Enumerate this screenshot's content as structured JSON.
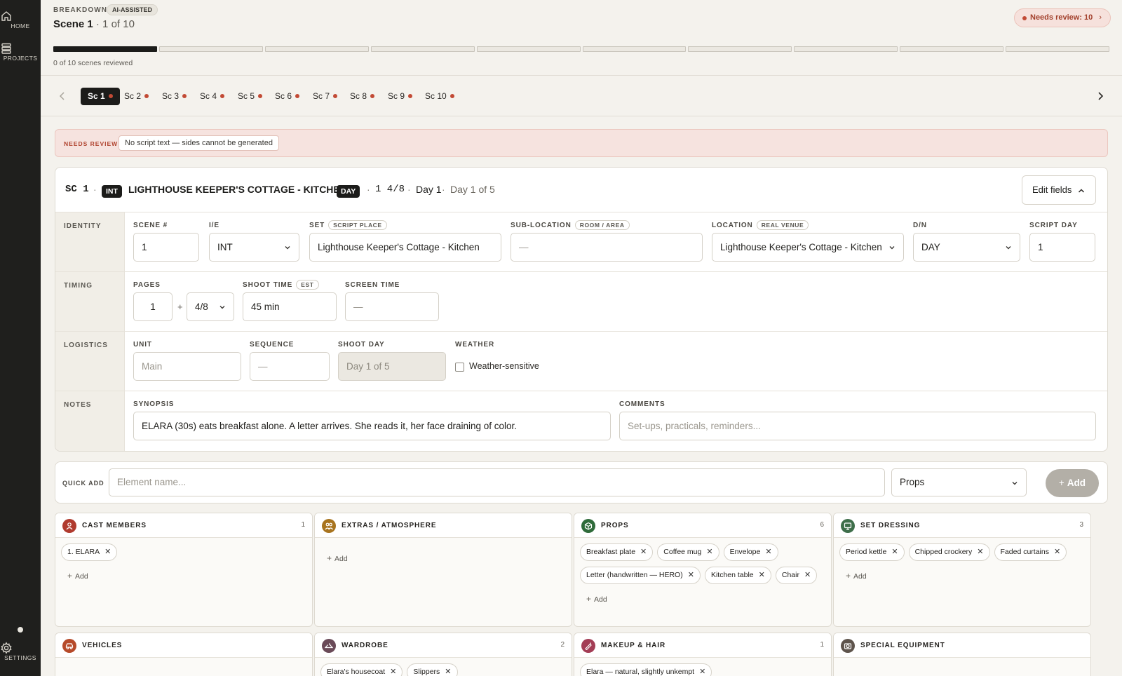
{
  "rail": {
    "home": "HOME",
    "projects": "PROJECTS",
    "settings": "SETTINGS"
  },
  "header": {
    "breadcrumb": "BREAKDOWN",
    "ai_badge": "AI-ASSISTED",
    "scene_title": "Scene 1",
    "scene_position": "· 1 of 10",
    "review_pill": "Needs review: 10",
    "scenes_reviewed_fraction": 0.1,
    "progress_label": "0 of 10 scenes reviewed"
  },
  "tabs": [
    {
      "label": "Sc 1"
    },
    {
      "label": "Sc 2"
    },
    {
      "label": "Sc 3"
    },
    {
      "label": "Sc 4"
    },
    {
      "label": "Sc 5"
    },
    {
      "label": "Sc 6"
    },
    {
      "label": "Sc 7"
    },
    {
      "label": "Sc 8"
    },
    {
      "label": "Sc 9"
    },
    {
      "label": "Sc 10"
    }
  ],
  "alert": {
    "label": "NEEDS REVIEW",
    "message": "No script text — sides cannot be generated"
  },
  "slugline": {
    "scene_code": "SC 1",
    "ie": "INT",
    "set": "LIGHTHOUSE KEEPER'S COTTAGE - KITCHEN",
    "dn": "DAY",
    "pages": "1 4/8",
    "script_day": "Day 1",
    "shoot_day": "Day 1 of 5",
    "edit_label": "Edit fields"
  },
  "sections": {
    "identity": "IDENTITY",
    "timing": "TIMING",
    "logistics": "LOGISTICS",
    "notes": "NOTES"
  },
  "identity": {
    "scene_label": "SCENE #",
    "scene_value": "1",
    "ie_label": "I/E",
    "ie_value": "INT",
    "set_label": "SET",
    "set_tag": "SCRIPT PLACE",
    "set_value": "Lighthouse Keeper's Cottage - Kitchen",
    "sublocation_label": "SUB-LOCATION",
    "sublocation_tag": "ROOM / AREA",
    "sublocation_value": "—",
    "location_label": "LOCATION",
    "location_tag": "REAL VENUE",
    "location_value": "Lighthouse Keeper's Cottage - Kitchen",
    "dn_label": "D/N",
    "dn_value": "DAY",
    "script_day_label": "SCRIPT DAY",
    "script_day_value": "1"
  },
  "timing": {
    "pages_label": "PAGES",
    "pages_whole": "1",
    "plus": "+",
    "pages_eighths": "4/8",
    "shoot_time_label": "SHOOT TIME",
    "shoot_time_tag": "EST",
    "shoot_time_value": "45 min",
    "screen_time_label": "SCREEN TIME",
    "screen_time_value": "—"
  },
  "logistics": {
    "unit_label": "UNIT",
    "unit_placeholder": "Main",
    "sequence_label": "SEQUENCE",
    "sequence_value": "—",
    "shoot_day_label": "SHOOT DAY",
    "shoot_day_value": "Day 1 of 5",
    "weather_label": "WEATHER",
    "weather_checkbox": "Weather-sensitive"
  },
  "notes": {
    "synopsis_label": "SYNOPSIS",
    "synopsis_value": "ELARA (30s) eats breakfast alone. A letter arrives. She reads it, her face draining of color.",
    "comments_label": "COMMENTS",
    "comments_placeholder": "Set-ups, practicals, reminders..."
  },
  "quick_add": {
    "label": "QUICK ADD",
    "placeholder": "Element name...",
    "category": "Props",
    "button": "Add"
  },
  "add_label": "Add",
  "categories": [
    {
      "title": "CAST MEMBERS",
      "count": "1",
      "color": "#b03a2e",
      "items": [
        "1. ELARA"
      ]
    },
    {
      "title": "EXTRAS / ATMOSPHERE",
      "count": "",
      "color": "#a8741f",
      "items": []
    },
    {
      "title": "PROPS",
      "count": "6",
      "color": "#2f6b3a",
      "items": [
        "Breakfast plate",
        "Coffee mug",
        "Envelope",
        "Letter (handwritten — HERO)",
        "Kitchen table",
        "Chair"
      ]
    },
    {
      "title": "SET DRESSING",
      "count": "3",
      "color": "#3e6e4a",
      "items": [
        "Period kettle",
        "Chipped crockery",
        "Faded curtains"
      ]
    },
    {
      "title": "VEHICLES",
      "count": "",
      "color": "#b64a2a",
      "items": []
    },
    {
      "title": "WARDROBE",
      "count": "2",
      "color": "#6a4a58",
      "items": [
        "Elara's housecoat",
        "Slippers"
      ]
    },
    {
      "title": "MAKEUP & HAIR",
      "count": "1",
      "color": "#a33d55",
      "items": [
        "Elara — natural, slightly unkempt"
      ]
    },
    {
      "title": "SPECIAL EQUIPMENT",
      "count": "",
      "color": "#5e544c",
      "items": []
    }
  ]
}
